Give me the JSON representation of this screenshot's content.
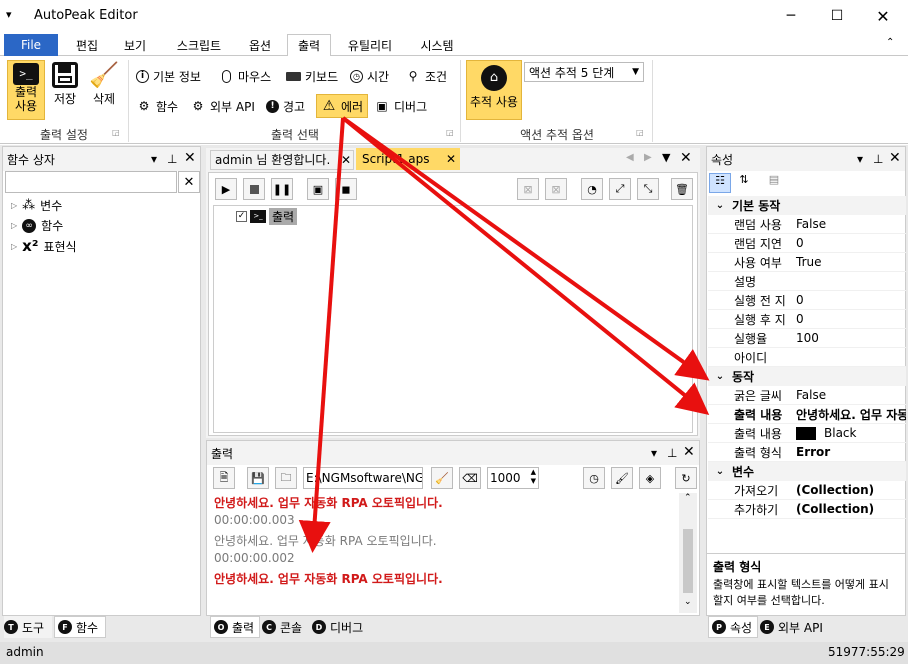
{
  "window": {
    "title": "AutoPeak Editor"
  },
  "ribbon_tabs": [
    "File",
    "편집",
    "보기",
    "스크립트",
    "옵션",
    "출력",
    "유틸리티",
    "시스템"
  ],
  "ribbon": {
    "output_settings": {
      "btn_output_use": "출력\n사용",
      "btn_save": "저장",
      "btn_delete": "삭제",
      "label": "출력 설정"
    },
    "output_select": {
      "row1": [
        "기본 정보",
        "마우스",
        "키보드",
        "시간",
        "조건"
      ],
      "row2": [
        "함수",
        "외부 API",
        "경고",
        "에러",
        "디버그"
      ],
      "label": "출력 선택"
    },
    "action_trace": {
      "btn_trace_use": "추적 사용",
      "dropdown_value": "액션 추적 5 단계",
      "label": "액션 추적 옵션"
    }
  },
  "function_box": {
    "title": "함수 상자",
    "items": [
      "변수",
      "함수",
      "표현식"
    ],
    "tab_tools": "도구",
    "tab_functions": "함수"
  },
  "doc_tabs": {
    "tab1": "admin 님 환영합니다.",
    "tab2": "Script1.aps"
  },
  "script_tree": {
    "node_label": "출력"
  },
  "output_panel": {
    "title": "출력",
    "path": "E:\\NGMsoftware\\NG",
    "count": "1000",
    "lines": [
      {
        "text": "안녕하세요. 업무 자동화 RPA 오토픽입니다.",
        "color": "#d11a1a",
        "bold": true
      },
      {
        "text": "00:00:00.003",
        "color": "#7a7a7a",
        "bold": false
      },
      {
        "text": "안녕하세요. 업무 자동화 RPA 오토픽입니다.",
        "color": "#7a7a7a",
        "bold": false
      },
      {
        "text": "00:00:00.002",
        "color": "#7a7a7a",
        "bold": false
      },
      {
        "text": "안녕하세요. 업무 자동화 RPA 오토픽입니다.",
        "color": "#d11a1a",
        "bold": true
      }
    ],
    "tabs": [
      "출력",
      "콘솔",
      "디버그"
    ]
  },
  "properties": {
    "title": "속성",
    "cat_basic": "기본 동작",
    "basic": [
      {
        "k": "랜덤 사용",
        "v": "False"
      },
      {
        "k": "랜덤 지연",
        "v": "0"
      },
      {
        "k": "사용 여부",
        "v": "True"
      },
      {
        "k": "설명",
        "v": ""
      },
      {
        "k": "실행 전 지",
        "v": "0"
      },
      {
        "k": "실행 후 지",
        "v": "0"
      },
      {
        "k": "실행율",
        "v": "100"
      },
      {
        "k": "아이디",
        "v": ""
      }
    ],
    "cat_action": "동작",
    "action": [
      {
        "k": "굵은 글씨",
        "v": "False"
      },
      {
        "k": "출력 내용",
        "v": "안녕하세요. 업무 자동"
      },
      {
        "k": "출력 내용",
        "v": "Black"
      },
      {
        "k": "출력 형식",
        "v": "Error"
      }
    ],
    "cat_var": "변수",
    "vars": [
      {
        "k": "가져오기",
        "v": "(Collection)"
      },
      {
        "k": "추가하기",
        "v": "(Collection)"
      }
    ],
    "desc_title": "출력 형식",
    "desc_text": "출력창에 표시할 텍스트를 어떻게 표시할지 여부를 선택합니다.",
    "tab_props": "속성",
    "tab_api": "외부 API"
  },
  "status": {
    "user": "admin",
    "time": "51977:55:29"
  },
  "colors": {
    "accent": "#2b67c6",
    "highlight": "#ffd966",
    "arrow": "#e8100f"
  }
}
